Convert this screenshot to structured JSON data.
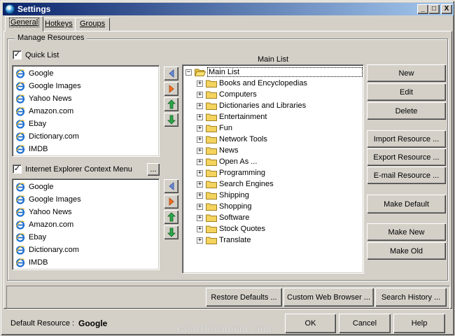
{
  "window": {
    "title": "Settings",
    "controls": [
      "_",
      "□",
      "X"
    ]
  },
  "tabs": [
    "General",
    "Hotkeys",
    "Groups"
  ],
  "group_label": "Manage Resources",
  "quick_list": {
    "label": "Quick List",
    "checked": true,
    "items": [
      "Google",
      "Google Images",
      "Yahoo News",
      "Amazon.com",
      "Ebay",
      "Dictionary.com",
      "IMDB"
    ]
  },
  "ie_context": {
    "label": "Internet Explorer Context Menu",
    "checked": true,
    "browse_label": "...",
    "items": [
      "Google",
      "Google Images",
      "Yahoo News",
      "Amazon.com",
      "Ebay",
      "Dictionary.com",
      "IMDB"
    ]
  },
  "main_list": {
    "label": "Main List",
    "root": "Main List",
    "folders": [
      "Books and Encyclopedias",
      "Computers",
      "Dictionaries and Libraries",
      "Entertainment",
      "Fun",
      "Network Tools",
      "News",
      "Open As ...",
      "Programming",
      "Search Engines",
      "Shipping",
      "Shopping",
      "Software",
      "Stock Quotes",
      "Translate"
    ]
  },
  "right_buttons": {
    "new": "New",
    "edit": "Edit",
    "delete": "Delete",
    "import": "Import Resource ...",
    "export": "Export Resource ...",
    "email": "E-mail Resource ...",
    "make_default": "Make Default",
    "make_new": "Make New",
    "make_old": "Make Old"
  },
  "bottom_buttons": {
    "restore": "Restore Defaults ...",
    "custom_browser": "Custom Web Browser ...",
    "search_history": "Search History ..."
  },
  "footer": {
    "default_label": "Default Resource :",
    "default_value": "Google",
    "ok": "OK",
    "cancel": "Cancel",
    "help": "Help"
  },
  "watermark": "GearDownload.com",
  "colors": {
    "titlebar_start": "#0a246a",
    "titlebar_end": "#a6caf0",
    "face": "#d4d0c8",
    "folder": "#f4d35e",
    "arrow_left": "#6a8ad8",
    "arrow_right": "#f07020",
    "arrow_up": "#2aa84a",
    "arrow_down": "#2aa84a"
  }
}
